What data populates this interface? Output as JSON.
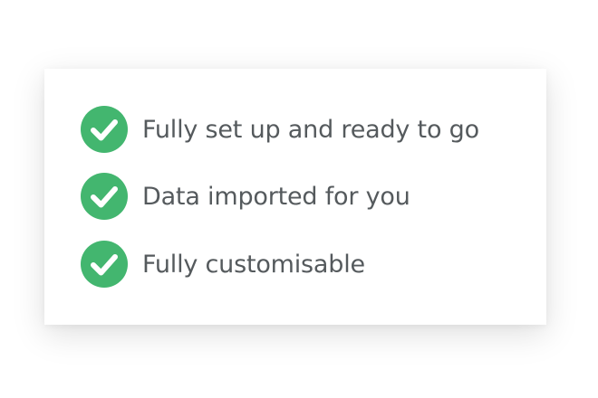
{
  "colors": {
    "check_background": "#43b66f",
    "check_mark": "#ffffff",
    "text": "#555a5d"
  },
  "features": [
    {
      "icon": "check-circle-icon",
      "label": "Fully set up and ready to go"
    },
    {
      "icon": "check-circle-icon",
      "label": "Data imported for you"
    },
    {
      "icon": "check-circle-icon",
      "label": "Fully customisable"
    }
  ]
}
